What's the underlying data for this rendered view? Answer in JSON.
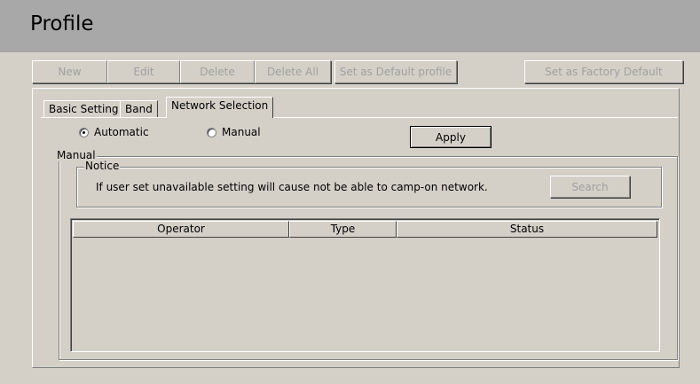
{
  "header": {
    "title": "Profile"
  },
  "toolbar": {
    "new_label": "New",
    "edit_label": "Edit",
    "delete_label": "Delete",
    "delete_all_label": "Delete All",
    "set_default_label": "Set as Default profile",
    "set_factory_label": "Set as Factory Default"
  },
  "tabs": {
    "basic": "Basic Setting",
    "band": "Band",
    "network": "Network Selection",
    "active": "Network Selection"
  },
  "network": {
    "automatic_label": "Automatic",
    "manual_label": "Manual",
    "selected_mode": "Automatic",
    "apply_label": "Apply",
    "manual_group_label": "Manual",
    "notice_group_label": "Notice",
    "notice_text": "If user set unavailable setting will cause  not be able to camp-on network.",
    "search_label": "Search",
    "columns": [
      "Operator",
      "Type",
      "Status"
    ],
    "rows": []
  },
  "colors": {
    "background": "#d4d0c8",
    "header": "#a8a8a8",
    "disabled_text": "#a0a0a0"
  }
}
